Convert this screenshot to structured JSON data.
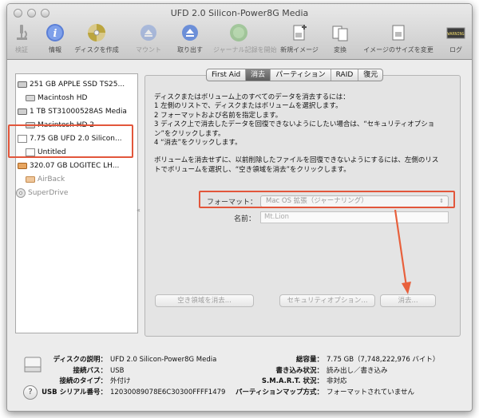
{
  "window": {
    "title": "UFD 2.0 Silicon-Power8G Media"
  },
  "toolbar": {
    "items": [
      {
        "label": "検証",
        "icon": "microscope-icon",
        "enabled": false
      },
      {
        "label": "情報",
        "icon": "info-icon",
        "enabled": true
      },
      {
        "label": "ディスクを作成",
        "icon": "disc-burn-icon",
        "enabled": true
      },
      {
        "label": "マウント",
        "icon": "mount-icon",
        "enabled": false
      },
      {
        "label": "取り出す",
        "icon": "eject-icon",
        "enabled": true
      },
      {
        "label": "ジャーナル記録を開始",
        "icon": "journal-icon",
        "enabled": false
      },
      {
        "label": "新規イメージ",
        "icon": "new-image-icon",
        "enabled": true
      },
      {
        "label": "変換",
        "icon": "convert-icon",
        "enabled": true
      },
      {
        "label": "イメージのサイズを変更",
        "icon": "resize-image-icon",
        "enabled": true
      },
      {
        "label": "ログ",
        "icon": "log-icon",
        "enabled": true
      },
      {
        "log_badge": "WARNING"
      }
    ]
  },
  "sidebar": {
    "items": [
      {
        "label": "251 GB APPLE SSD TS25...",
        "kind": "disk",
        "gray": false
      },
      {
        "label": "Macintosh HD",
        "kind": "volume",
        "gray": false
      },
      {
        "label": "1 TB ST31000528AS Media",
        "kind": "disk",
        "gray": false
      },
      {
        "label": "Macintosh HD 2",
        "kind": "volume",
        "gray": false
      },
      {
        "label": "7.75 GB UFD 2.0 Silicon...",
        "kind": "usb",
        "gray": false
      },
      {
        "label": "Untitled",
        "kind": "volume-empty",
        "gray": false
      },
      {
        "label": "320.07 GB LOGITEC LH...",
        "kind": "disk-orange",
        "gray": false
      },
      {
        "label": "AirBack",
        "kind": "volume-orange",
        "gray": true
      },
      {
        "label": "SuperDrive",
        "kind": "optical",
        "gray": true
      }
    ]
  },
  "tabs": [
    {
      "label": "First Aid",
      "active": false
    },
    {
      "label": "消去",
      "active": true
    },
    {
      "label": "パーティション",
      "active": false
    },
    {
      "label": "RAID",
      "active": false
    },
    {
      "label": "復元",
      "active": false
    }
  ],
  "erase": {
    "instructions": [
      "ディスクまたはボリューム上のすべてのデータを消去するには：",
      "1 左側のリストで、ディスクまたはボリュームを選択します。",
      "2 フォーマットおよび名前を指定します。",
      "3 ディスク上で消去したデータを回復できないようにしたい場合は、“セキュリティオプショ",
      "   ン”をクリックします。",
      "4 “消去”をクリックします。",
      "",
      "ボリュームを消去せずに、以前削除したファイルを回復できないようにするには、左側のリス",
      "トでボリュームを選択し、“空き領域を消去”をクリックします。"
    ],
    "format_label": "フォーマット：",
    "format_value": "Mac OS 拡張（ジャーナリング）",
    "name_label": "名前：",
    "name_value": "Mt.Lion",
    "erase_free_space_button": "空き領域を消去...",
    "security_options_button": "セキュリティオプション...",
    "erase_button": "消去..."
  },
  "info": {
    "left": [
      {
        "k": "ディスクの説明：",
        "v": "UFD 2.0 Silicon-Power8G Media"
      },
      {
        "k": "接続バス：",
        "v": "USB"
      },
      {
        "k": "接続のタイプ：",
        "v": "外付け"
      },
      {
        "k": "USB シリアル番号：",
        "v": "12030089078E6C30300FFFF1479"
      }
    ],
    "right": [
      {
        "k": "総容量：",
        "v": "7.75 GB（7,748,222,976 バイト）"
      },
      {
        "k": "書き込み状況：",
        "v": "読み出し／書き込み"
      },
      {
        "k": "S.M.A.R.T. 状況：",
        "v": "非対応"
      },
      {
        "k": "パーティションマップ方式：",
        "v": "フォーマットされていません"
      }
    ]
  },
  "help_label": "?",
  "colors": {
    "highlight": "#e2563b",
    "arrow": "#e8603c"
  }
}
